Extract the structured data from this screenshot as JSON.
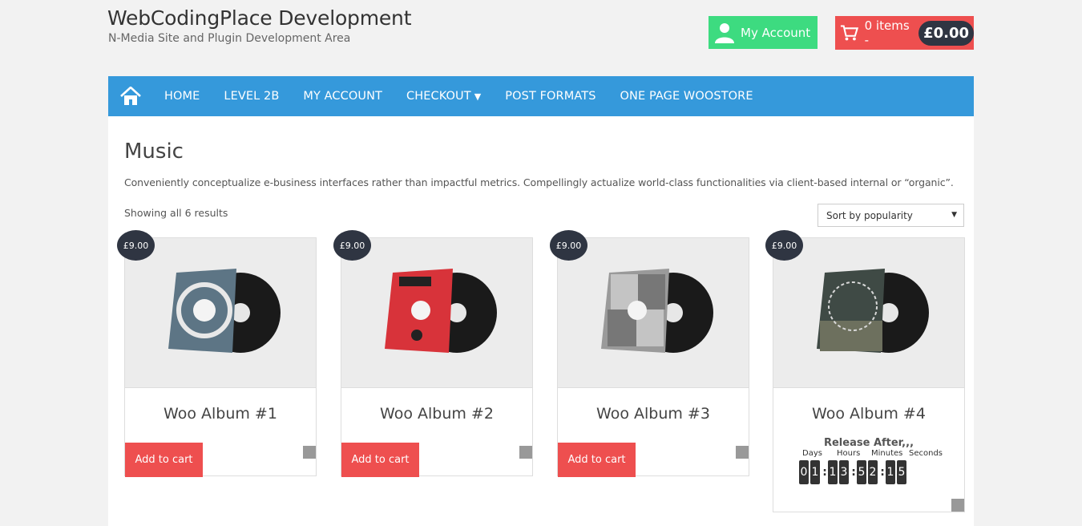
{
  "site": {
    "title": "WebCodingPlace Development",
    "tagline": "N-Media Site and Plugin Development Area"
  },
  "header": {
    "account_label": "My Account",
    "cart_count": "0 items -",
    "cart_total": "£0.00"
  },
  "nav": {
    "items": [
      "HOME",
      "LEVEL 2B",
      "MY ACCOUNT",
      "CHECKOUT",
      "POST FORMATS",
      "ONE PAGE WOOSTORE"
    ]
  },
  "page": {
    "title": "Music",
    "description": "Conveniently conceptualize e-business interfaces rather than impactful metrics. Compellingly actualize world-class functionalities via client-based internal or “organic”.",
    "result_count": "Showing all 6 results",
    "sort_selected": "Sort by popularity"
  },
  "products": [
    {
      "name": "Woo Album #1",
      "price": "£9.00",
      "add_label": "Add to cart",
      "cover": "#5d7585"
    },
    {
      "name": "Woo Album #2",
      "price": "£9.00",
      "add_label": "Add to cart",
      "cover": "#d8333a"
    },
    {
      "name": "Woo Album #3",
      "price": "£9.00",
      "add_label": "Add to cart",
      "cover": "#8a8a8a"
    },
    {
      "name": "Woo Album #4",
      "price": "£9.00",
      "cover": "#3f4a45"
    }
  ],
  "countdown": {
    "title": "Release After,,,",
    "labels": [
      "Days",
      "Hours",
      "Minutes",
      "Seconds"
    ],
    "days": "01",
    "hours": "13",
    "minutes": "52",
    "seconds": "15"
  },
  "colors": {
    "nav": "#3599db",
    "account": "#3ddb80",
    "cart": "#ee4f4f",
    "badge": "#2f3542"
  }
}
